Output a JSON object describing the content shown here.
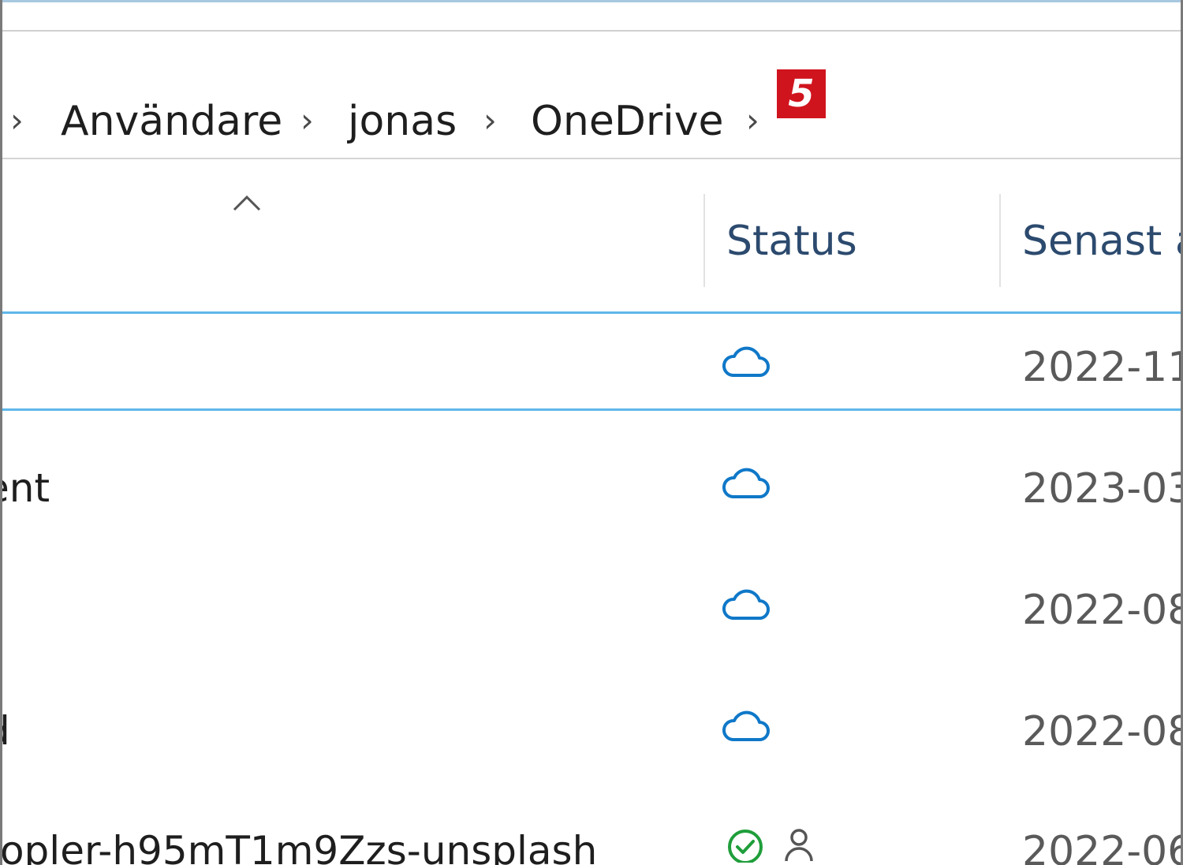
{
  "breadcrumb": {
    "items": [
      "Användare",
      "jonas",
      "OneDrive"
    ],
    "badge": "5",
    "separator": "›"
  },
  "columns": {
    "status": "Status",
    "modified": "Senast ä"
  },
  "rows": [
    {
      "name": "",
      "status": "cloud-icon",
      "date": "2022-11"
    },
    {
      "name": "ent",
      "status": "cloud-icon",
      "date": "2023-03"
    },
    {
      "name": "",
      "status": "cloud-icon",
      "date": "2022-08"
    },
    {
      "name": "d",
      "status": "cloud-icon",
      "date": "2022-08"
    },
    {
      "name": "-opler-h95mT1m9Zzs-unsplash",
      "status": "check-circle-icon",
      "date": "2022-06"
    }
  ],
  "colors": {
    "accent": "#0f78c8",
    "selection": "#5fb7ea",
    "badge": "#d0141e",
    "synced": "#1f9e3b"
  }
}
